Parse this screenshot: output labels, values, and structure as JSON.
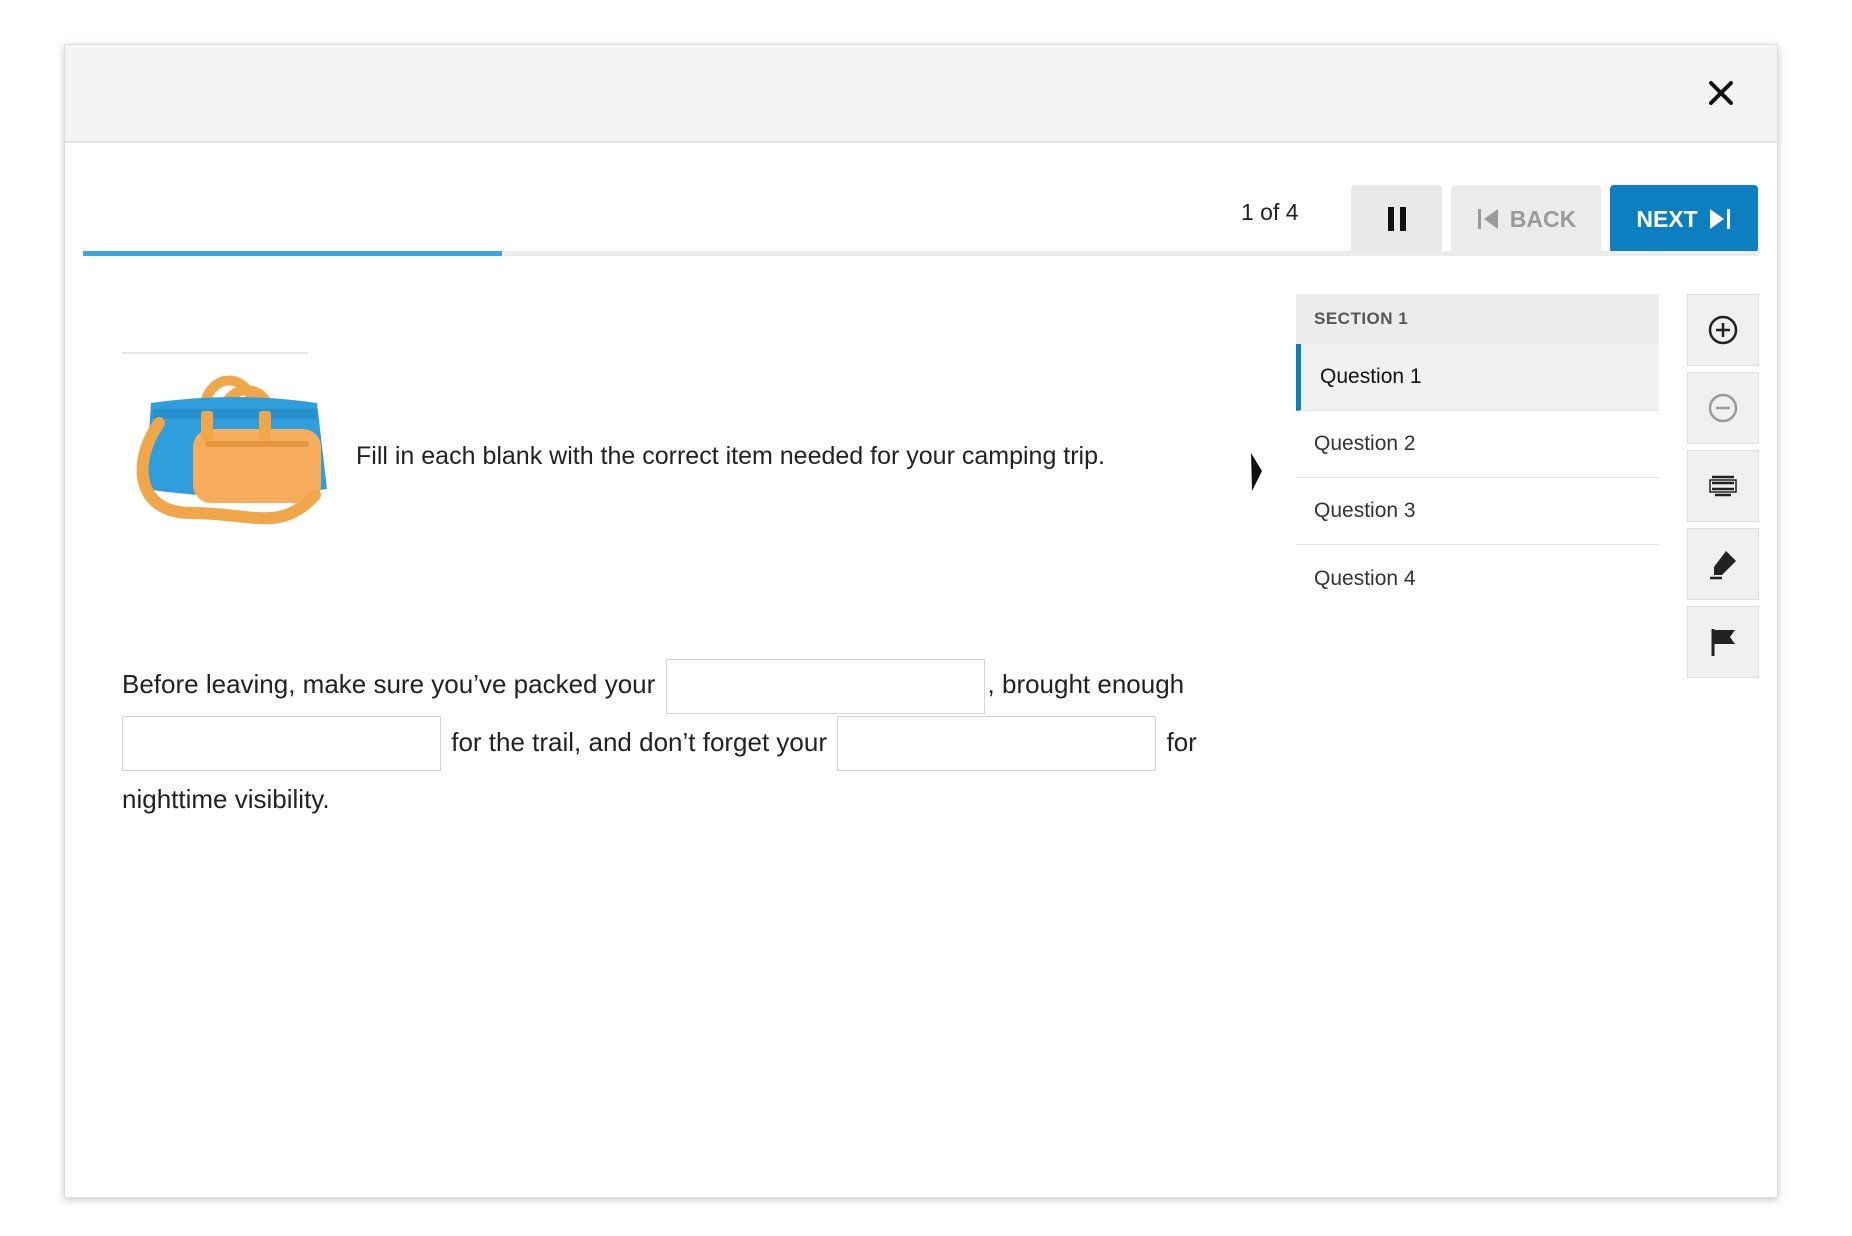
{
  "header": {
    "close_icon": "close-icon"
  },
  "toolbar": {
    "counter": "1 of 4",
    "pause_icon": "pause-icon",
    "back_label": "BACK",
    "next_label": "NEXT",
    "progress": 0.25,
    "colors": {
      "accent": "#0b7fc0",
      "progress": "#3ba6dc"
    }
  },
  "question": {
    "image_icon": "duffel-bag-illustration",
    "prompt": "Fill in each blank with the correct item needed for your camping trip.",
    "passage": {
      "part1": "Before leaving, make sure you’ve packed your",
      "part2": ", brought enough",
      "part3": "for the trail, and don’t forget your",
      "part4": "for nighttime visibility."
    },
    "blanks": [
      "",
      "",
      ""
    ]
  },
  "nav": {
    "section_label": "SECTION 1",
    "items": [
      {
        "label": "Question 1",
        "active": true
      },
      {
        "label": "Question 2",
        "active": false
      },
      {
        "label": "Question 3",
        "active": false
      },
      {
        "label": "Question 4",
        "active": false
      }
    ]
  },
  "tools": [
    "zoom-in-icon",
    "zoom-out-icon",
    "line-reader-icon",
    "highlighter-icon",
    "flag-icon"
  ]
}
